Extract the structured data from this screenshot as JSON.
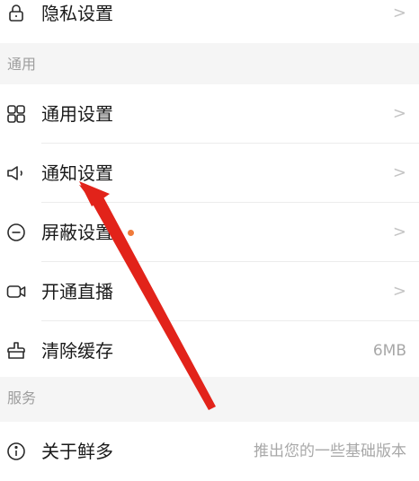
{
  "rows": [
    {
      "label": "隐私设置",
      "icon": "lock-icon",
      "chevron": ">"
    },
    {
      "label": "通用设置",
      "icon": "grid-icon",
      "chevron": ">"
    },
    {
      "label": "通知设置",
      "icon": "speaker-icon",
      "chevron": ">"
    },
    {
      "label": "屏蔽设置",
      "icon": "block-icon",
      "chevron": ">",
      "badge_color": "#f07a3a"
    },
    {
      "label": "开通直播",
      "icon": "live-camera-icon",
      "chevron": ">"
    },
    {
      "label": "清除缓存",
      "icon": "broom-icon",
      "value": "6MB"
    },
    {
      "label": "关于鲜多",
      "icon": "info-icon",
      "value": "推出您的一些基础版本"
    }
  ],
  "sections": {
    "general": "通用",
    "services": "服务"
  },
  "colors": {
    "annotation_arrow": "#e2231a",
    "background": "#f5f5f5",
    "chevron": "#c4c4c4"
  }
}
